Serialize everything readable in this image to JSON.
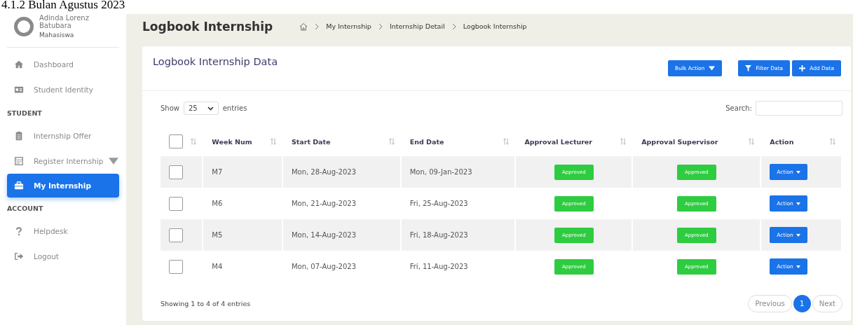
{
  "caption": "4.1.2 Bulan Agustus 2023",
  "profile": {
    "name": "Adinda Lorenz Batubara",
    "role": "Mahasiswa"
  },
  "sidebar": {
    "items": [
      {
        "kind": "link",
        "label": "Dashboard",
        "selected": false,
        "has_submenu": false
      },
      {
        "kind": "link",
        "label": "Student Identity",
        "selected": false,
        "has_submenu": false
      },
      {
        "kind": "section",
        "label": "STUDENT"
      },
      {
        "kind": "link",
        "label": "Internship Offer",
        "selected": false,
        "has_submenu": false
      },
      {
        "kind": "link",
        "label": "Register Internship",
        "selected": false,
        "has_submenu": true
      },
      {
        "kind": "link",
        "label": "My Internship",
        "selected": true,
        "has_submenu": false
      },
      {
        "kind": "section",
        "label": "ACCOUNT"
      },
      {
        "kind": "link",
        "label": "Helpdesk",
        "selected": false,
        "has_submenu": false
      },
      {
        "kind": "link",
        "label": "Logout",
        "selected": false,
        "has_submenu": false
      }
    ]
  },
  "page_title": "Logbook Internship",
  "breadcrumb": [
    "My Internship",
    "Internship Detail",
    "Logbook Internship"
  ],
  "card": {
    "title": "Logbook Internship Data",
    "buttons": [
      {
        "kind": "dropdown",
        "label": "Bulk Action"
      },
      {
        "kind": "filter",
        "label": "Filter Data"
      },
      {
        "kind": "add",
        "label": "Add Data"
      }
    ]
  },
  "length_control": {
    "prefix": "Show",
    "value": "25",
    "suffix": "entries"
  },
  "search": {
    "label": "Search:"
  },
  "table": {
    "header_checkbox": {
      "checked": false
    },
    "columns": [
      "Week Num",
      "Start Date",
      "End Date",
      "Approval Lecturer",
      "Approval Supervisor",
      "Action"
    ],
    "rows": [
      {
        "checked": false,
        "week": "M7",
        "start": "Mon, 28-Aug-2023",
        "end": "Mon, 09-Jan-2023",
        "lecturer": "Approved",
        "supervisor": "Approved",
        "action": "Action"
      },
      {
        "checked": false,
        "week": "M6",
        "start": "Mon, 21-Aug-2023",
        "end": "Fri, 25-Aug-2023",
        "lecturer": "Approved",
        "supervisor": "Approved",
        "action": "Action"
      },
      {
        "checked": false,
        "week": "M5",
        "start": "Mon, 14-Aug-2023",
        "end": "Fri, 18-Aug-2023",
        "lecturer": "Approved",
        "supervisor": "Approved",
        "action": "Action"
      },
      {
        "checked": false,
        "week": "M4",
        "start": "Mon, 07-Aug-2023",
        "end": "Fri, 11-Aug-2023",
        "lecturer": "Approved",
        "supervisor": "Approved",
        "action": "Action"
      }
    ]
  },
  "info": "Showing 1 to 4 of 4 entries",
  "pagination": {
    "previous": "Previous",
    "pages": [
      {
        "label": "1",
        "selected": true
      }
    ],
    "next": "Next"
  }
}
